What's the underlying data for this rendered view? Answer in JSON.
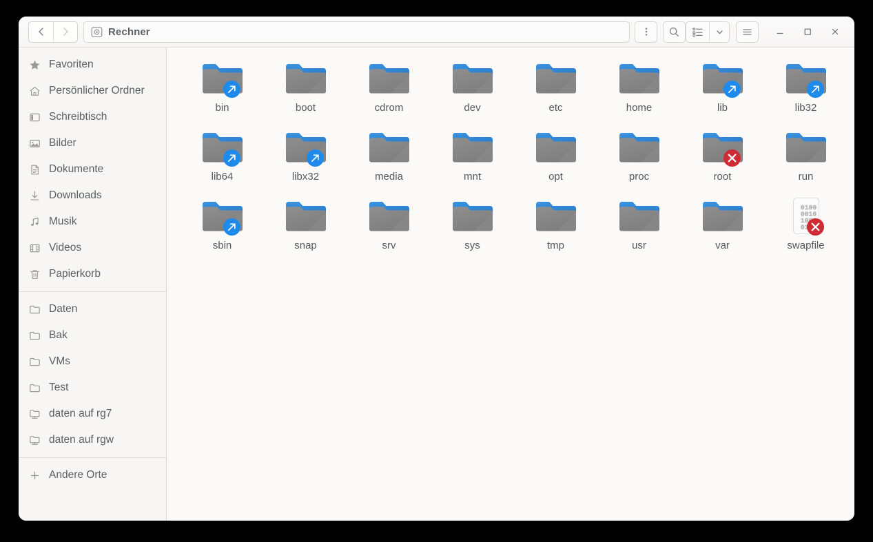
{
  "window": {
    "title": "Rechner",
    "controls": {
      "minimize_label": "–",
      "maximize_label": "□",
      "close_label": "✕"
    }
  },
  "header": {
    "back_icon": "chevron-left-icon",
    "forward_icon": "chevron-right-icon",
    "pathbar": {
      "icon": "drive-icon",
      "crumb": "Rechner"
    },
    "menu_dots_icon": "vertical-ellipsis-icon",
    "search_icon": "search-icon",
    "view_list_icon": "list-view-icon",
    "view_dropdown_icon": "chevron-down-icon",
    "hamburger_icon": "hamburger-menu-icon"
  },
  "sidebar": {
    "groups": [
      {
        "items": [
          {
            "label": "Favoriten",
            "icon": "star-icon"
          },
          {
            "label": "Persönlicher Ordner",
            "icon": "home-icon"
          },
          {
            "label": "Schreibtisch",
            "icon": "desktop-icon"
          },
          {
            "label": "Bilder",
            "icon": "image-icon"
          },
          {
            "label": "Dokumente",
            "icon": "document-icon"
          },
          {
            "label": "Downloads",
            "icon": "download-icon"
          },
          {
            "label": "Musik",
            "icon": "music-note-icon"
          },
          {
            "label": "Videos",
            "icon": "film-icon"
          },
          {
            "label": "Papierkorb",
            "icon": "trash-icon"
          }
        ]
      },
      {
        "items": [
          {
            "label": "Daten",
            "icon": "folder-icon"
          },
          {
            "label": "Bak",
            "icon": "folder-icon"
          },
          {
            "label": "VMs",
            "icon": "folder-icon"
          },
          {
            "label": "Test",
            "icon": "folder-icon"
          },
          {
            "label": "daten auf rg7",
            "icon": "network-folder-icon"
          },
          {
            "label": "daten auf rgw",
            "icon": "network-folder-icon"
          }
        ]
      },
      {
        "items": [
          {
            "label": "Andere Orte",
            "icon": "plus-icon"
          }
        ]
      }
    ]
  },
  "main": {
    "items": [
      {
        "name": "bin",
        "type": "folder",
        "emblem": "symlink"
      },
      {
        "name": "boot",
        "type": "folder",
        "emblem": null
      },
      {
        "name": "cdrom",
        "type": "folder",
        "emblem": null
      },
      {
        "name": "dev",
        "type": "folder",
        "emblem": null
      },
      {
        "name": "etc",
        "type": "folder",
        "emblem": null
      },
      {
        "name": "home",
        "type": "folder",
        "emblem": null
      },
      {
        "name": "lib",
        "type": "folder",
        "emblem": "symlink"
      },
      {
        "name": "lib32",
        "type": "folder",
        "emblem": "symlink"
      },
      {
        "name": "lib64",
        "type": "folder",
        "emblem": "symlink"
      },
      {
        "name": "libx32",
        "type": "folder",
        "emblem": "symlink"
      },
      {
        "name": "media",
        "type": "folder",
        "emblem": null
      },
      {
        "name": "mnt",
        "type": "folder",
        "emblem": null
      },
      {
        "name": "opt",
        "type": "folder",
        "emblem": null
      },
      {
        "name": "proc",
        "type": "folder",
        "emblem": null
      },
      {
        "name": "root",
        "type": "folder",
        "emblem": "unreadable"
      },
      {
        "name": "run",
        "type": "folder",
        "emblem": null
      },
      {
        "name": "sbin",
        "type": "folder",
        "emblem": "symlink"
      },
      {
        "name": "snap",
        "type": "folder",
        "emblem": null
      },
      {
        "name": "srv",
        "type": "folder",
        "emblem": null
      },
      {
        "name": "sys",
        "type": "folder",
        "emblem": null
      },
      {
        "name": "tmp",
        "type": "folder",
        "emblem": null
      },
      {
        "name": "usr",
        "type": "folder",
        "emblem": null
      },
      {
        "name": "var",
        "type": "folder",
        "emblem": null
      },
      {
        "name": "swapfile",
        "type": "binary-file",
        "emblem": "unreadable"
      }
    ]
  },
  "colors": {
    "folder_blue": "#2a7fd3",
    "folder_gray": "#878787",
    "symlink_badge": "#1e8bec",
    "error_badge": "#cf2b35",
    "sidebar_bg": "#f7f6f5",
    "text": "#5a5f63",
    "title_text": "#5b6268"
  }
}
